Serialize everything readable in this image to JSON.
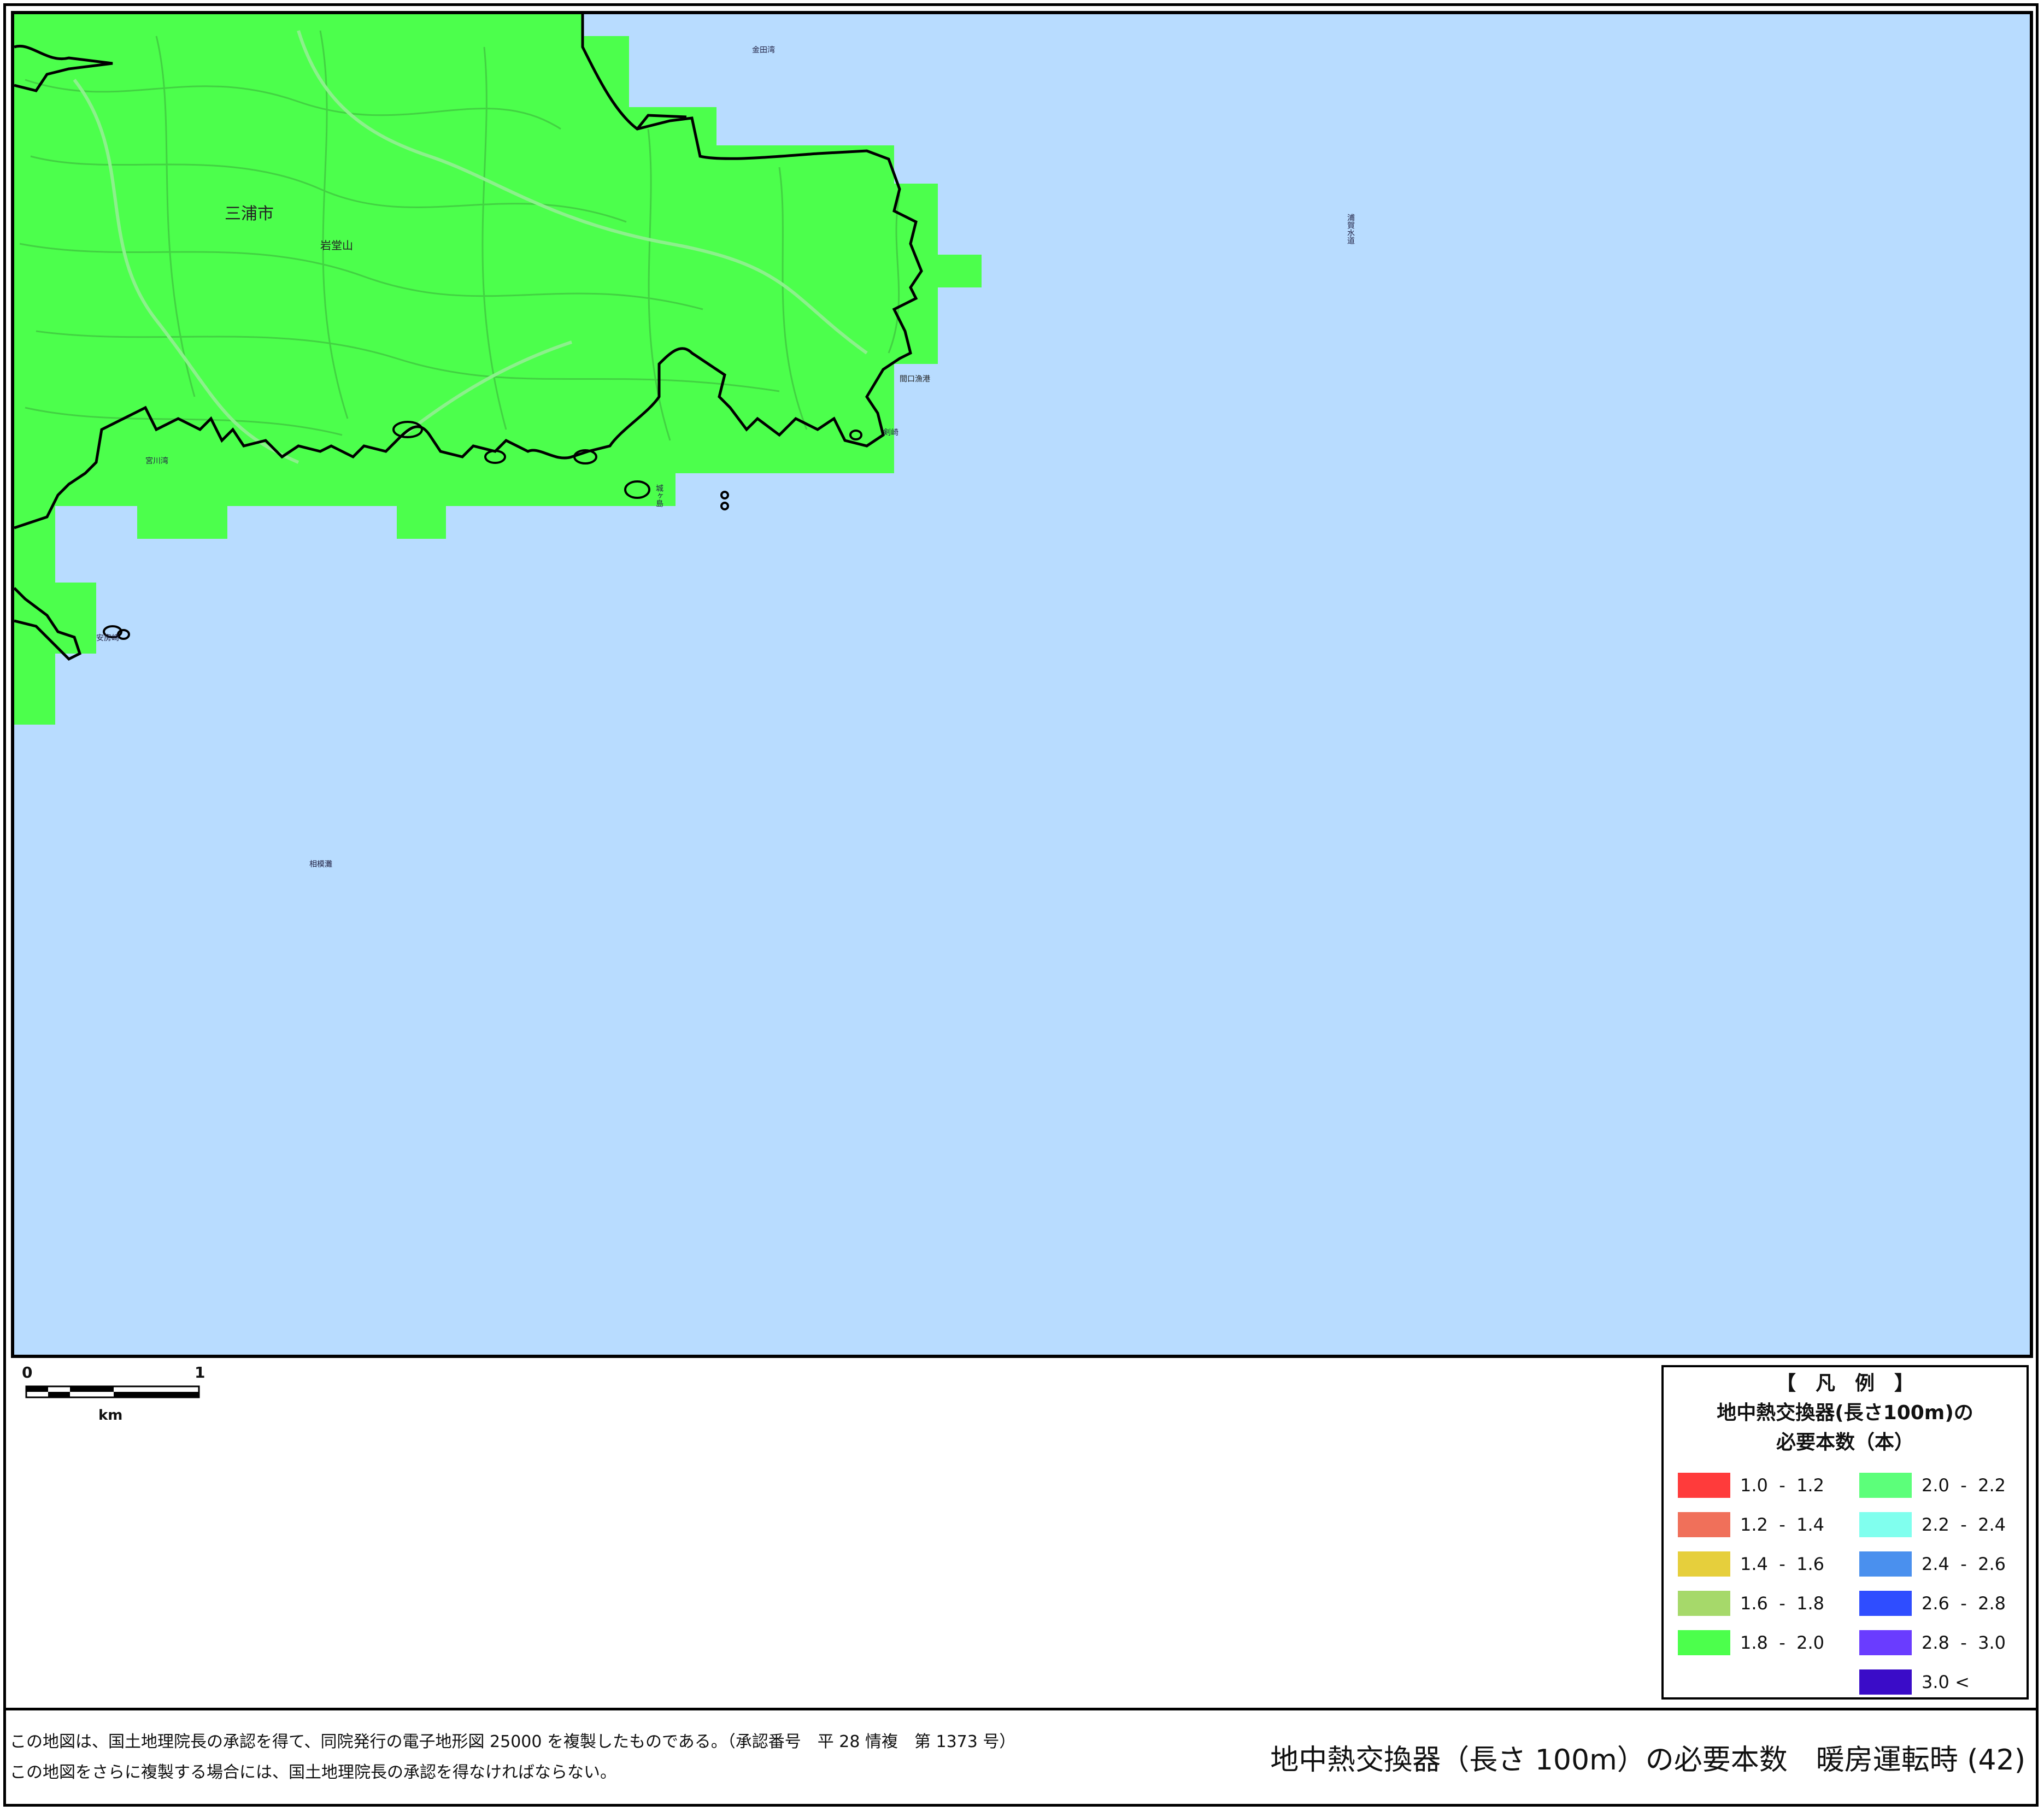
{
  "map": {
    "place_labels": {
      "city": "三浦市",
      "mountain": "岩堂山",
      "bay_kaneda": "金田湾",
      "channel": "浦賀水道",
      "fishing_port": "間口漁港",
      "bay_misaki": "宮川湾",
      "cape": "剣崎",
      "cape_south": "城ヶ島",
      "sea": "相模灘",
      "cape_west": "安房崎"
    },
    "colors": {
      "sea": "#b8dcff",
      "land_1_8_2_0": "#4cff4c",
      "coastline": "#000000",
      "contour": "#3fbf3f"
    }
  },
  "scalebar": {
    "zero": "0",
    "one": "1",
    "unit": "km"
  },
  "legend": {
    "title": "【　凡　例　】",
    "subtitle1": "地中熱交換器(長さ100m)の",
    "subtitle2": "必要本数（本）",
    "left_items": [
      {
        "label": "1.0  -  1.2",
        "color": "#ff3b3b"
      },
      {
        "label": "1.2  -  1.4",
        "color": "#f0705a"
      },
      {
        "label": "1.4  -  1.6",
        "color": "#e6cf3c"
      },
      {
        "label": "1.6  -  1.8",
        "color": "#a6d96a"
      },
      {
        "label": "1.8  -  2.0",
        "color": "#4cff4c"
      }
    ],
    "right_items": [
      {
        "label": "2.0  -  2.2",
        "color": "#5cff7a"
      },
      {
        "label": "2.2  -  2.4",
        "color": "#80ffee"
      },
      {
        "label": "2.4  -  2.6",
        "color": "#4a90ee"
      },
      {
        "label": "2.6  -  2.8",
        "color": "#2f4dff"
      },
      {
        "label": "2.8  -  3.0",
        "color": "#6a3cff"
      },
      {
        "label": "3.0 <",
        "color": "#3a0cc8"
      }
    ]
  },
  "footer": {
    "credit1": "この地図は、国土地理院長の承認を得て、同院発行の電子地形図 25000 を複製したものである。（承認番号　平 28 情複　第 1373 号）",
    "credit2": "この地図をさらに複製する場合には、国土地理院長の承認を得なければならない。",
    "title": "地中熱交換器（長さ 100m）の必要本数　暖房運転時 (42)"
  }
}
